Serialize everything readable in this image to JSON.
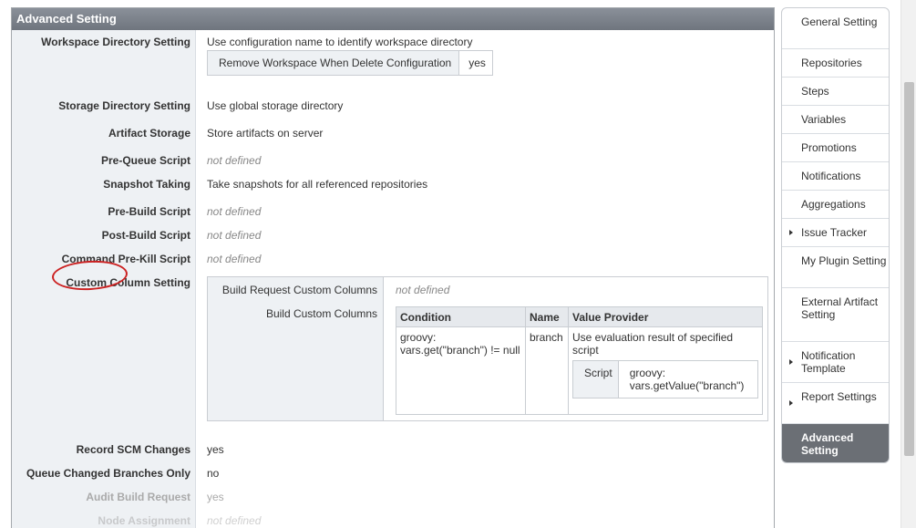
{
  "panel": {
    "title": "Advanced Setting"
  },
  "fields": {
    "workspace": {
      "label": "Workspace Directory Setting",
      "value": "Use configuration name to identify workspace directory",
      "sub_key": "Remove Workspace When Delete Configuration",
      "sub_value": "yes"
    },
    "storage_dir": {
      "label": "Storage Directory Setting",
      "value": "Use global storage directory"
    },
    "artifact_storage": {
      "label": "Artifact Storage",
      "value": "Store artifacts on server"
    },
    "pre_queue": {
      "label": "Pre-Queue Script",
      "value": "not defined"
    },
    "snapshot": {
      "label": "Snapshot Taking",
      "value": "Take snapshots for all referenced repositories"
    },
    "pre_build": {
      "label": "Pre-Build Script",
      "value": "not defined"
    },
    "post_build": {
      "label": "Post-Build Script",
      "value": "not defined"
    },
    "pre_kill": {
      "label": "Command Pre-Kill Script",
      "value": "not defined"
    },
    "custom_column": {
      "label": "Custom Column Setting"
    },
    "record_scm": {
      "label": "Record SCM Changes",
      "value": "yes"
    },
    "queue_changed": {
      "label": "Queue Changed Branches Only",
      "value": "no"
    },
    "audit_build": {
      "label": "Audit Build Request",
      "value": "yes"
    },
    "node_assignment": {
      "label": "Node Assignment",
      "value": "not defined"
    }
  },
  "custom_columns": {
    "build_request_label": "Build Request Custom Columns",
    "build_request_value": "not defined",
    "build_label": "Build Custom Columns",
    "headers": {
      "condition": "Condition",
      "name": "Name",
      "value_provider": "Value Provider"
    },
    "row": {
      "condition": "groovy: vars.get(\"branch\") != null",
      "name": "branch",
      "value_provider": "Use evaluation result of specified script",
      "script_label": "Script",
      "script_value": "groovy: vars.getValue(\"branch\")"
    }
  },
  "nav": {
    "items": [
      {
        "label": "General Setting"
      },
      {
        "label": "Repositories"
      },
      {
        "label": "Steps"
      },
      {
        "label": "Variables"
      },
      {
        "label": "Promotions"
      },
      {
        "label": "Notifications"
      },
      {
        "label": "Aggregations"
      },
      {
        "label": "Issue Tracker"
      },
      {
        "label": "My Plugin Setting"
      },
      {
        "label": "External Artifact Setting"
      },
      {
        "label": "Notification Template"
      },
      {
        "label": "Report Settings"
      },
      {
        "label": "Advanced Setting"
      }
    ],
    "active": "Advanced Setting"
  },
  "colors": {
    "header_bg": "#7a8089",
    "active_nav": "#6b6f75",
    "highlight_oval": "#cc2222"
  }
}
